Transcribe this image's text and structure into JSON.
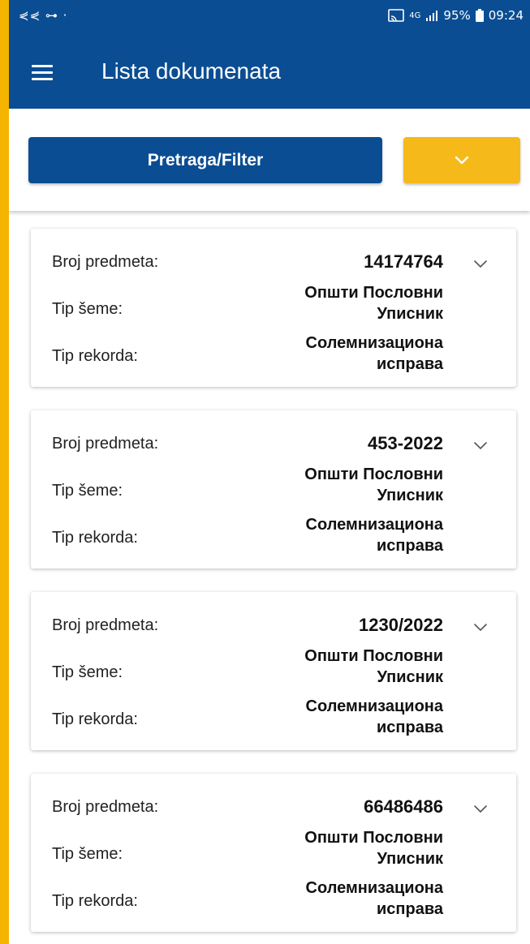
{
  "status_bar": {
    "left_icons": "⋞⋞ ⊶ ·",
    "signal_label": "4G",
    "battery": "95%",
    "time": "09:24"
  },
  "app_bar": {
    "title": "Lista dokumenata",
    "menu_icon": "hamburger-menu-icon"
  },
  "toolbar": {
    "search_label": "Pretraga/Filter",
    "dropdown_icon": "chevron-down-icon"
  },
  "colors": {
    "primary": "#0b4d93",
    "accent": "#f5b91a",
    "frame": "#f5b400"
  },
  "documents": [
    {
      "case_label": "Broj predmeta:",
      "case_number": "14174764",
      "schema_label": "Tip šeme:",
      "schema_value": "Општи Пословни Уписник",
      "schema_line1": "Општи Пословни",
      "schema_line2": "Уписник",
      "record_label": "Tip rekorda:",
      "record_line1": "Солемнизациона",
      "record_line2": "исправа"
    },
    {
      "case_label": "Broj predmeta:",
      "case_number": "453-2022",
      "schema_label": "Tip šeme:",
      "schema_line1": "Општи Пословни",
      "schema_line2": "Уписник",
      "record_label": "Tip rekorda:",
      "record_line1": "Солемнизациона",
      "record_line2": "исправа"
    },
    {
      "case_label": "Broj predmeta:",
      "case_number": "1230/2022",
      "schema_label": "Tip šeme:",
      "schema_line1": "Општи Пословни",
      "schema_line2": "Уписник",
      "record_label": "Tip rekorda:",
      "record_line1": "Солемнизациона",
      "record_line2": "исправа"
    },
    {
      "case_label": "Broj predmeta:",
      "case_number": "66486486",
      "schema_label": "Tip šeme:",
      "schema_line1": "Општи Пословни",
      "schema_line2": "Уписник",
      "record_label": "Tip rekorda:",
      "record_line1": "Солемнизациона",
      "record_line2": "исправа"
    }
  ]
}
